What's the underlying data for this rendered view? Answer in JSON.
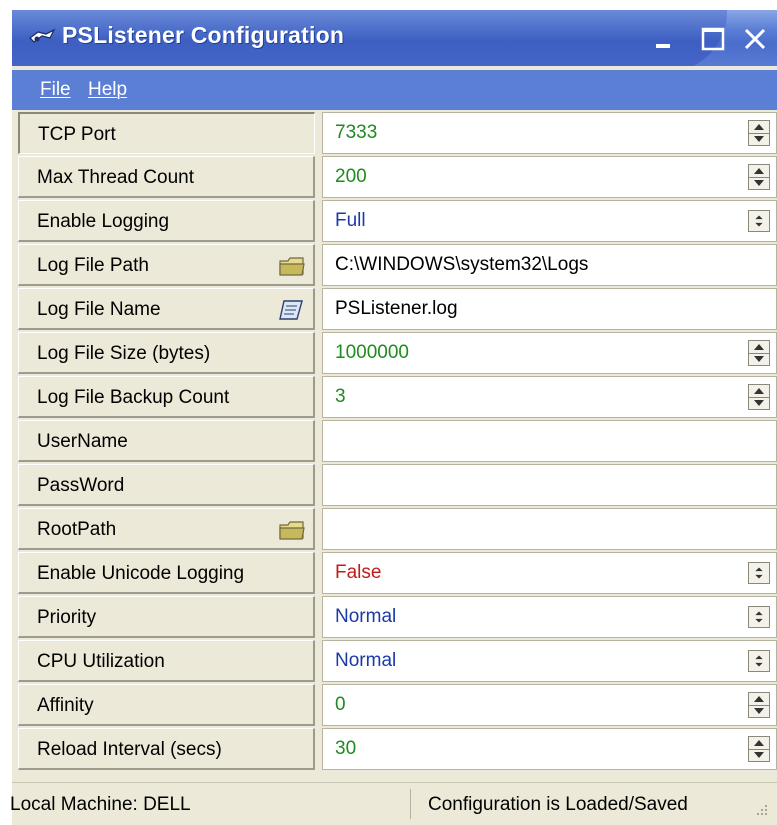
{
  "window": {
    "title": "PSListener Configuration",
    "icon": "psl-app-icon"
  },
  "menu": {
    "file": "File",
    "help": "Help"
  },
  "properties": [
    {
      "label": "TCP Port",
      "value": "7333",
      "editor": "spin",
      "color": "#1f8a1f",
      "selected": true
    },
    {
      "label": "Max Thread Count",
      "value": "200",
      "editor": "spin",
      "color": "#1f8a1f"
    },
    {
      "label": "Enable Logging",
      "value": "Full",
      "editor": "dropdown",
      "color": "#1a3aa8"
    },
    {
      "label": "Log File Path",
      "value": "C:\\WINDOWS\\system32\\Logs",
      "editor": "text",
      "color": "#000000",
      "icon": "folder-icon"
    },
    {
      "label": "Log File Name",
      "value": "PSListener.log",
      "editor": "text",
      "color": "#000000",
      "icon": "notepad-icon"
    },
    {
      "label": "Log File Size (bytes)",
      "value": "1000000",
      "editor": "spin",
      "color": "#1f8a1f"
    },
    {
      "label": "Log File Backup Count",
      "value": "3",
      "editor": "spin",
      "color": "#1f8a1f"
    },
    {
      "label": "UserName",
      "value": "",
      "editor": "text",
      "color": "#000000"
    },
    {
      "label": "PassWord",
      "value": "",
      "editor": "text",
      "color": "#000000"
    },
    {
      "label": "RootPath",
      "value": "",
      "editor": "text",
      "color": "#000000",
      "icon": "folder-icon"
    },
    {
      "label": "Enable Unicode Logging",
      "value": "False",
      "editor": "dropdown",
      "color": "#c41a1a"
    },
    {
      "label": "Priority",
      "value": "Normal",
      "editor": "dropdown",
      "color": "#1a3aa8"
    },
    {
      "label": "CPU Utilization",
      "value": "Normal",
      "editor": "dropdown",
      "color": "#1a3aa8"
    },
    {
      "label": "Affinity",
      "value": "0",
      "editor": "spin",
      "color": "#1f8a1f"
    },
    {
      "label": "Reload Interval (secs)",
      "value": "30",
      "editor": "spin",
      "color": "#1f8a1f"
    }
  ],
  "status": {
    "machine": "Local Machine: DELL",
    "state": "Configuration is Loaded/Saved"
  }
}
